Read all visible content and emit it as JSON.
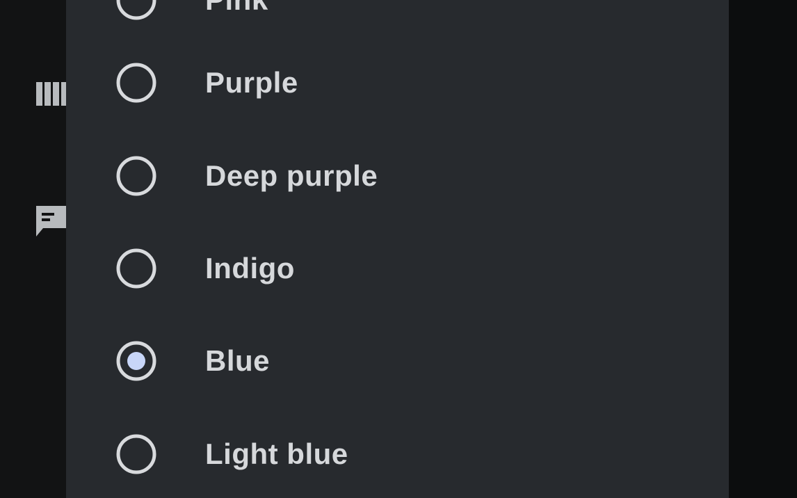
{
  "dialog": {
    "options": [
      {
        "label": "Pink",
        "selected": false
      },
      {
        "label": "Purple",
        "selected": false
      },
      {
        "label": "Deep purple",
        "selected": false
      },
      {
        "label": "Indigo",
        "selected": false
      },
      {
        "label": "Blue",
        "selected": true
      },
      {
        "label": "Light blue",
        "selected": false
      }
    ]
  },
  "background": {
    "icons": [
      "view-column-icon",
      "feedback-icon"
    ]
  },
  "colors": {
    "dialog_background": "#272a2e",
    "radio_ring": "#d8dadd",
    "radio_selected_dot": "#c8d6f8",
    "text": "#d6d8db"
  }
}
